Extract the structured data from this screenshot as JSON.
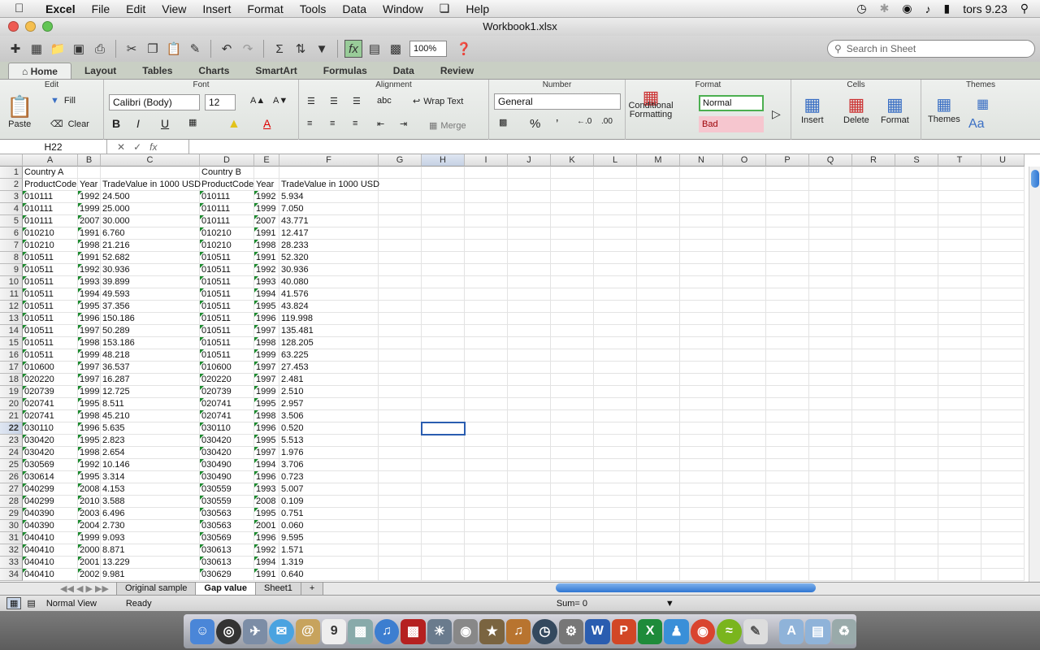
{
  "menubar": {
    "app": "Excel",
    "items": [
      "File",
      "Edit",
      "View",
      "Insert",
      "Format",
      "Tools",
      "Data",
      "Window",
      "Help"
    ],
    "clock": "tors 9.23"
  },
  "window": {
    "title": "Workbook1.xlsx"
  },
  "toolbar": {
    "zoom": "100%",
    "search_placeholder": "Search in Sheet"
  },
  "ribbon": {
    "tabs": [
      "Home",
      "Layout",
      "Tables",
      "Charts",
      "SmartArt",
      "Formulas",
      "Data",
      "Review"
    ],
    "groups": {
      "edit": "Edit",
      "font": "Font",
      "alignment": "Alignment",
      "number": "Number",
      "format": "Format",
      "cells": "Cells",
      "themes": "Themes"
    },
    "paste": "Paste",
    "fill": "Fill",
    "clear": "Clear",
    "font_name": "Calibri (Body)",
    "font_size": "12",
    "wrap_text": "Wrap Text",
    "merge": "Merge",
    "abc": "abc",
    "number_format": "General",
    "conditional": "Conditional Formatting",
    "style_normal": "Normal",
    "style_bad": "Bad",
    "insert": "Insert",
    "delete": "Delete",
    "format": "Format",
    "themes": "Themes"
  },
  "formula_bar": {
    "name_box": "H22",
    "fx": "fx",
    "formula": ""
  },
  "columns": [
    "A",
    "B",
    "C",
    "D",
    "E",
    "F",
    "G",
    "H",
    "I",
    "J",
    "K",
    "L",
    "M",
    "N",
    "O",
    "P",
    "Q",
    "R",
    "S",
    "T",
    "U"
  ],
  "rows": [
    [
      "Country A",
      "",
      "",
      "Country B",
      "",
      ""
    ],
    [
      "ProductCode",
      "Year",
      "TradeValue in 1000 USD",
      "ProductCode",
      "Year",
      "TradeValue in 1000 USD"
    ],
    [
      "010111",
      "1992",
      "24.500",
      "010111",
      "1992",
      "5.934"
    ],
    [
      "010111",
      "1999",
      "25.000",
      "010111",
      "1999",
      "7.050"
    ],
    [
      "010111",
      "2007",
      "30.000",
      "010111",
      "2007",
      "43.771"
    ],
    [
      "010210",
      "1991",
      "6.760",
      "010210",
      "1991",
      "12.417"
    ],
    [
      "010210",
      "1998",
      "21.216",
      "010210",
      "1998",
      "28.233"
    ],
    [
      "010511",
      "1991",
      "52.682",
      "010511",
      "1991",
      "52.320"
    ],
    [
      "010511",
      "1992",
      "30.936",
      "010511",
      "1992",
      "30.936"
    ],
    [
      "010511",
      "1993",
      "39.899",
      "010511",
      "1993",
      "40.080"
    ],
    [
      "010511",
      "1994",
      "49.593",
      "010511",
      "1994",
      "41.576"
    ],
    [
      "010511",
      "1995",
      "37.356",
      "010511",
      "1995",
      "43.824"
    ],
    [
      "010511",
      "1996",
      "150.186",
      "010511",
      "1996",
      "119.998"
    ],
    [
      "010511",
      "1997",
      "50.289",
      "010511",
      "1997",
      "135.481"
    ],
    [
      "010511",
      "1998",
      "153.186",
      "010511",
      "1998",
      "128.205"
    ],
    [
      "010511",
      "1999",
      "48.218",
      "010511",
      "1999",
      "63.225"
    ],
    [
      "010600",
      "1997",
      "36.537",
      "010600",
      "1997",
      "27.453"
    ],
    [
      "020220",
      "1997",
      "16.287",
      "020220",
      "1997",
      "2.481"
    ],
    [
      "020739",
      "1999",
      "12.725",
      "020739",
      "1999",
      "2.510"
    ],
    [
      "020741",
      "1995",
      "8.511",
      "020741",
      "1995",
      "2.957"
    ],
    [
      "020741",
      "1998",
      "45.210",
      "020741",
      "1998",
      "3.506"
    ],
    [
      "030110",
      "1996",
      "5.635",
      "030110",
      "1996",
      "0.520"
    ],
    [
      "030420",
      "1995",
      "2.823",
      "030420",
      "1995",
      "5.513"
    ],
    [
      "030420",
      "1998",
      "2.654",
      "030420",
      "1997",
      "1.976"
    ],
    [
      "030569",
      "1992",
      "10.146",
      "030490",
      "1994",
      "3.706"
    ],
    [
      "030614",
      "1995",
      "3.314",
      "030490",
      "1996",
      "0.723"
    ],
    [
      "040299",
      "2008",
      "4.153",
      "030559",
      "1993",
      "5.007"
    ],
    [
      "040299",
      "2010",
      "3.588",
      "030559",
      "2008",
      "0.109"
    ],
    [
      "040390",
      "2003",
      "6.496",
      "030563",
      "1995",
      "0.751"
    ],
    [
      "040390",
      "2004",
      "2.730",
      "030563",
      "2001",
      "0.060"
    ],
    [
      "040410",
      "1999",
      "9.093",
      "030569",
      "1996",
      "9.595"
    ],
    [
      "040410",
      "2000",
      "8.871",
      "030613",
      "1992",
      "1.571"
    ],
    [
      "040410",
      "2001",
      "13.229",
      "030613",
      "1994",
      "1.319"
    ],
    [
      "040410",
      "2002",
      "9.981",
      "030629",
      "1991",
      "0.640"
    ]
  ],
  "sheets": [
    "Original sample",
    "Gap value",
    "Sheet1"
  ],
  "active_sheet": "Gap value",
  "status": {
    "view": "Normal View",
    "state": "Ready",
    "sum": "Sum= 0"
  }
}
